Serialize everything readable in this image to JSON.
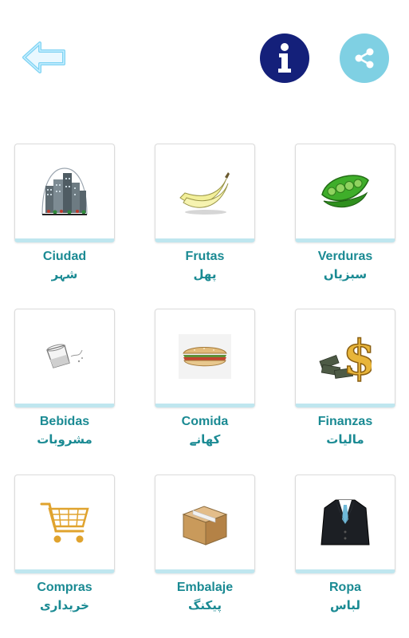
{
  "header": {
    "back_icon": "back-arrow-icon",
    "info_icon": "info-icon",
    "share_icon": "share-icon",
    "colors": {
      "info_bg": "#14207a",
      "share_bg": "#7fd0e3",
      "arrow": "#8fd8f5"
    }
  },
  "categories": [
    {
      "name": "Ciudad",
      "urdu": "شہر",
      "icon": "city-icon"
    },
    {
      "name": "Frutas",
      "urdu": "پھل",
      "icon": "banana-icon"
    },
    {
      "name": "Verduras",
      "urdu": "سبزیاں",
      "icon": "peas-icon"
    },
    {
      "name": "Bebidas",
      "urdu": "مشروبات",
      "icon": "drink-glass-icon"
    },
    {
      "name": "Comida",
      "urdu": "کھانے",
      "icon": "sandwich-icon"
    },
    {
      "name": "Finanzas",
      "urdu": "مالیات",
      "icon": "dollar-icon"
    },
    {
      "name": "Compras",
      "urdu": "خریداری",
      "icon": "shopping-cart-icon"
    },
    {
      "name": "Embalaje",
      "urdu": "پیکنگ",
      "icon": "box-icon"
    },
    {
      "name": "Ropa",
      "urdu": "لباس",
      "icon": "suit-icon"
    }
  ],
  "label_color": "#1a8a93"
}
